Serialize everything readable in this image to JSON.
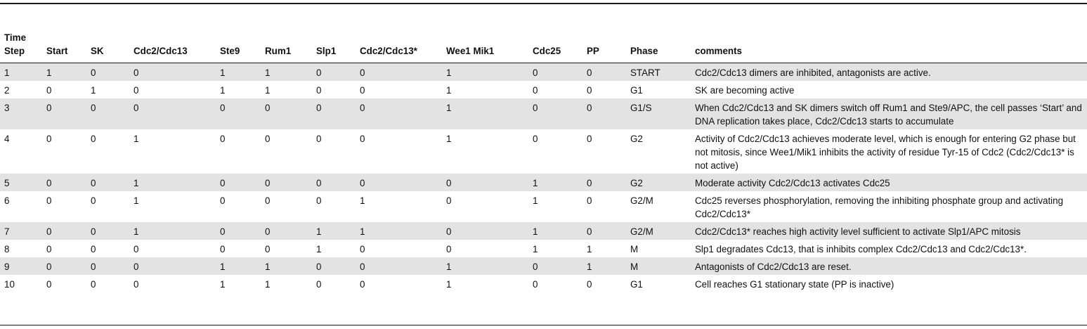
{
  "table": {
    "headers": {
      "time_step": "Time Step",
      "start": "Start",
      "sk": "SK",
      "cdc2_cdc13": "Cdc2/Cdc13",
      "ste9": "Ste9",
      "rum1": "Rum1",
      "slp1": "Slp1",
      "cdc2_cdc13_star": "Cdc2/Cdc13*",
      "wee1_mik1": "Wee1 Mik1",
      "cdc25": "Cdc25",
      "pp": "PP",
      "phase": "Phase",
      "comments": "comments"
    },
    "rows": [
      {
        "step": "1",
        "start": "1",
        "sk": "0",
        "cdc2": "0",
        "ste9": "1",
        "rum1": "1",
        "slp1": "0",
        "cdc2star": "0",
        "wee1": "1",
        "cdc25": "0",
        "pp": "0",
        "phase": "START",
        "comment": "Cdc2/Cdc13 dimers are inhibited, antagonists are active."
      },
      {
        "step": "2",
        "start": "0",
        "sk": "1",
        "cdc2": "0",
        "ste9": "1",
        "rum1": "1",
        "slp1": "0",
        "cdc2star": "0",
        "wee1": "1",
        "cdc25": "0",
        "pp": "0",
        "phase": "G1",
        "comment": "SK are becoming active"
      },
      {
        "step": "3",
        "start": "0",
        "sk": "0",
        "cdc2": "0",
        "ste9": "0",
        "rum1": "0",
        "slp1": "0",
        "cdc2star": "0",
        "wee1": "1",
        "cdc25": "0",
        "pp": "0",
        "phase": "G1/S",
        "comment": "When Cdc2/Cdc13 and SK dimers switch off Rum1 and Ste9/APC, the cell passes ‘Start’ and DNA replication takes place, Cdc2/Cdc13 starts to accumulate"
      },
      {
        "step": "4",
        "start": "0",
        "sk": "0",
        "cdc2": "1",
        "ste9": "0",
        "rum1": "0",
        "slp1": "0",
        "cdc2star": "0",
        "wee1": "1",
        "cdc25": "0",
        "pp": "0",
        "phase": "G2",
        "comment": "Activity of Cdc2/Cdc13 achieves moderate level, which is enough for entering G2 phase but not mitosis, since Wee1/Mik1 inhibits the activity of residue Tyr-15 of Cdc2 (Cdc2/Cdc13* is not active)"
      },
      {
        "step": "5",
        "start": "0",
        "sk": "0",
        "cdc2": "1",
        "ste9": "0",
        "rum1": "0",
        "slp1": "0",
        "cdc2star": "0",
        "wee1": "0",
        "cdc25": "1",
        "pp": "0",
        "phase": "G2",
        "comment": "Moderate activity Cdc2/Cdc13 activates Cdc25"
      },
      {
        "step": "6",
        "start": "0",
        "sk": "0",
        "cdc2": "1",
        "ste9": "0",
        "rum1": "0",
        "slp1": "0",
        "cdc2star": "1",
        "wee1": "0",
        "cdc25": "1",
        "pp": "0",
        "phase": "G2/M",
        "comment": "Cdc25 reverses phosphorylation, removing the inhibiting phosphate group and activating Cdc2/Cdc13*"
      },
      {
        "step": "7",
        "start": "0",
        "sk": "0",
        "cdc2": "1",
        "ste9": "0",
        "rum1": "0",
        "slp1": "1",
        "cdc2star": "1",
        "wee1": "0",
        "cdc25": "1",
        "pp": "0",
        "phase": "G2/M",
        "comment": "Cdc2/Cdc13* reaches high activity level sufficient to activate Slp1/APC mitosis"
      },
      {
        "step": "8",
        "start": "0",
        "sk": "0",
        "cdc2": "0",
        "ste9": "0",
        "rum1": "0",
        "slp1": "1",
        "cdc2star": "0",
        "wee1": "0",
        "cdc25": "1",
        "pp": "1",
        "phase": "M",
        "comment": "Slp1 degradates Cdc13, that is inhibits complex Cdc2/Cdc13 and Cdc2/Cdc13*."
      },
      {
        "step": "9",
        "start": "0",
        "sk": "0",
        "cdc2": "0",
        "ste9": "1",
        "rum1": "1",
        "slp1": "0",
        "cdc2star": "0",
        "wee1": "1",
        "cdc25": "0",
        "pp": "1",
        "phase": "M",
        "comment": "Antagonists of Cdc2/Cdc13 are reset."
      },
      {
        "step": "10",
        "start": "0",
        "sk": "0",
        "cdc2": "0",
        "ste9": "1",
        "rum1": "1",
        "slp1": "0",
        "cdc2star": "0",
        "wee1": "1",
        "cdc25": "0",
        "pp": "0",
        "phase": "G1",
        "comment": "Cell reaches G1 stationary state (PP is inactive)"
      }
    ]
  }
}
